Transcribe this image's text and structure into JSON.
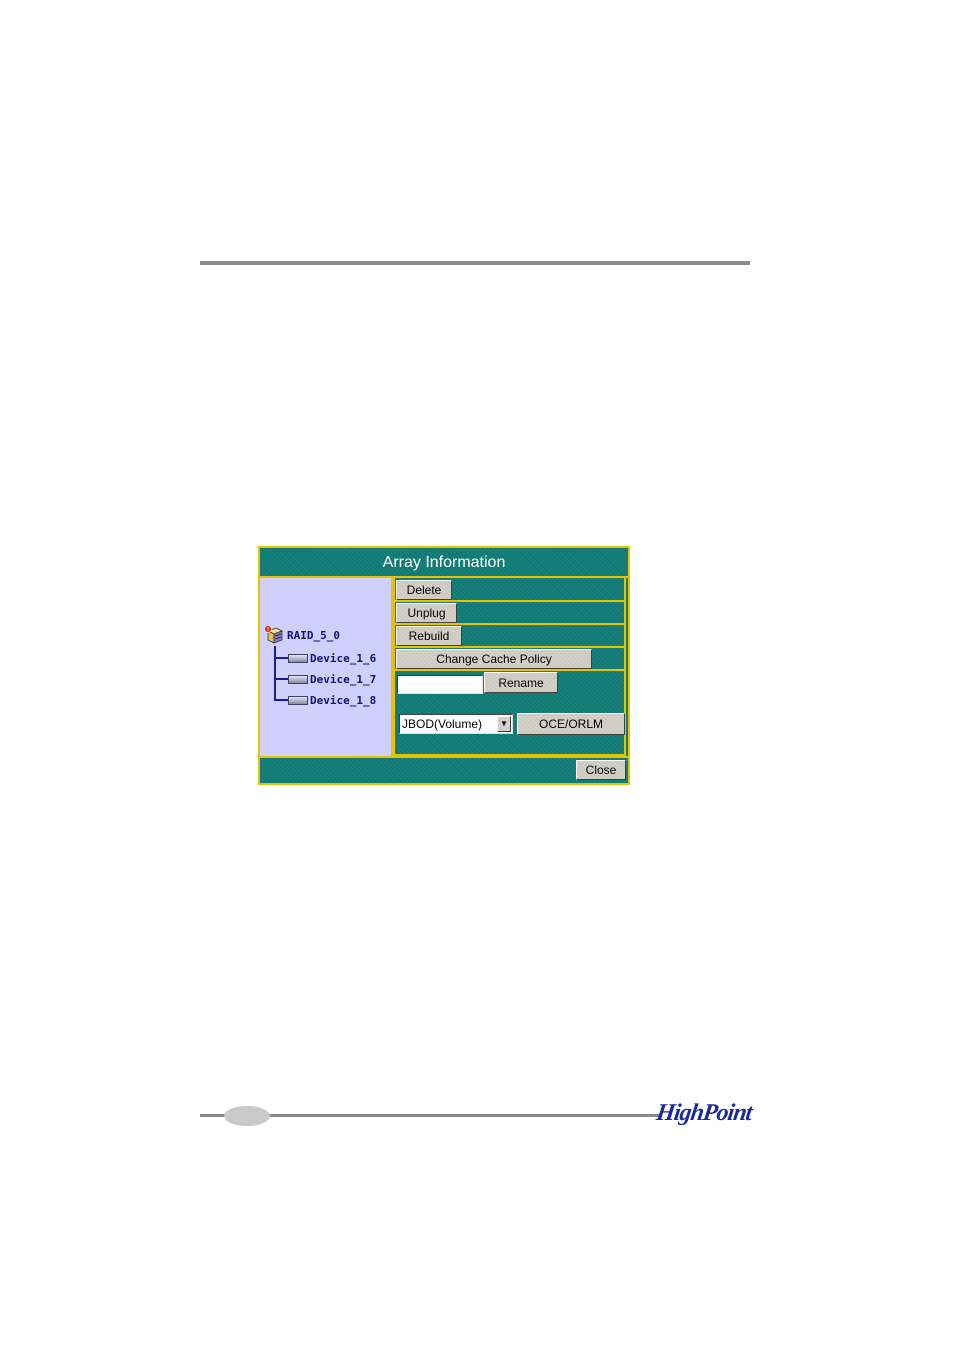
{
  "dialog": {
    "title": "Array Information",
    "close_label": "Close"
  },
  "tree": {
    "array": {
      "label": "RAID_5_0",
      "icon": "raid-array-icon"
    },
    "devices": [
      {
        "label": "Device_1_6",
        "icon": "disk-icon"
      },
      {
        "label": "Device_1_7",
        "icon": "disk-icon"
      },
      {
        "label": "Device_1_8",
        "icon": "disk-icon"
      }
    ]
  },
  "actions": {
    "delete_label": "Delete",
    "unplug_label": "Unplug",
    "rebuild_label": "Rebuild",
    "cache_policy_label": "Change Cache Policy",
    "rename_label": "Rename",
    "rename_value": "",
    "oce_select_value": "JBOD(Volume)",
    "oce_label": "OCE/ORLM"
  },
  "brand": {
    "logo_text": "HighPoint"
  },
  "colors": {
    "teal": "#0f7a73",
    "gold_border": "#e8c200",
    "tree_bg": "#cfd0fb",
    "tree_text": "#101080"
  }
}
